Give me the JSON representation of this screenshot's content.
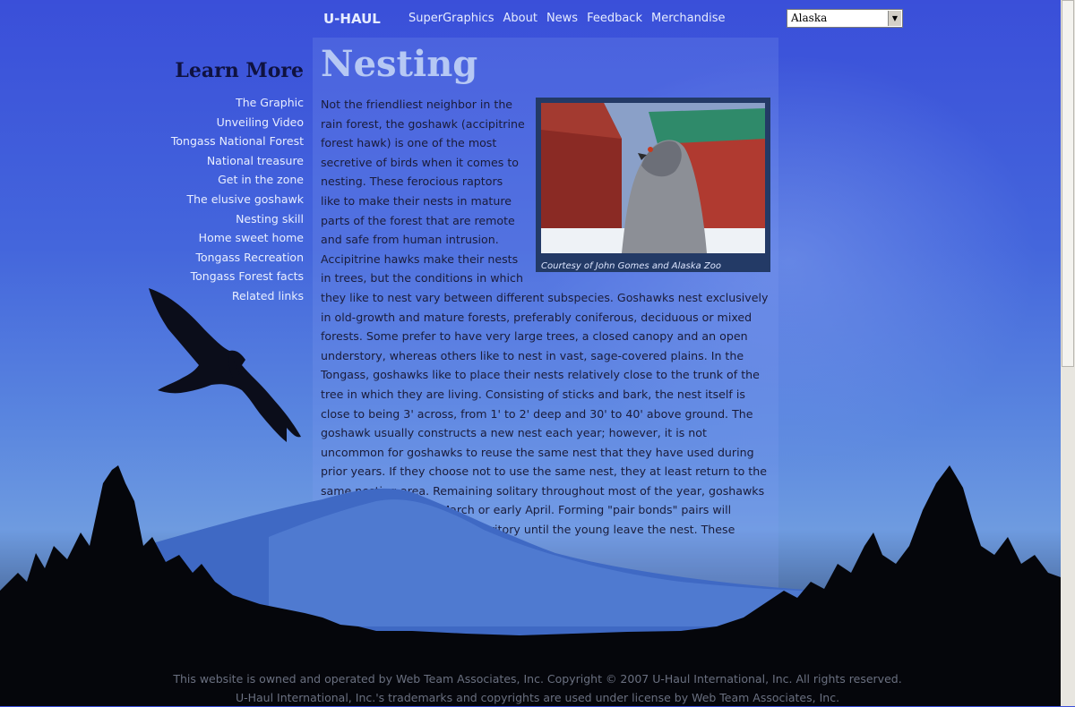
{
  "nav": {
    "logo": "U-HAUL",
    "links": [
      "SuperGraphics",
      "About",
      "News",
      "Feedback",
      "Merchandise"
    ],
    "state_select": "Alaska"
  },
  "sidebar": {
    "heading": "Learn More",
    "items": [
      "The Graphic",
      "Unveiling Video",
      "Tongass National Forest",
      "National treasure",
      "Get in the zone",
      "The elusive goshawk",
      "Nesting skill",
      "Home sweet home",
      "Tongass Recreation",
      "Tongass Forest facts",
      "Related links"
    ]
  },
  "article": {
    "title": "Nesting",
    "photo_caption": "Courtesy of John Gomes and Alaska Zoo",
    "body": "Not the friendliest neighbor in the rain forest, the goshawk (accipitrine forest hawk) is one of the most secretive of birds when it comes to nesting. These ferocious raptors like to make their nests in mature parts of the forest that are remote and safe from human intrusion. Accipitrine hawks make their nests in trees, but the conditions in which they like to nest vary between different subspecies. Goshawks nest exclusively in old-growth and mature forests, preferably coniferous, deciduous or mixed forests. Some prefer to have very large trees, a closed canopy and an open understory, whereas others like to nest in vast, sage-covered plains. In the Tongass, goshawks like to place their nests relatively close to the trunk of the tree in which they are living. Consisting of sticks and bark, the nest itself is close to being 3' across, from 1' to 2' deep and 30' to 40' above ground. The goshawk usually constructs a new nest each year; however, it is not uncommon for goshawks to reuse the same nest that they have used during prior years. If they choose not to use the same nest, they at least return to the same nesting area. Remaining solitary throughout most of the year, goshawks begin nesting in late March or early April. Forming \"pair bonds\" pairs will remain mated in the same territory until the young leave the nest. These young are ready before"
  },
  "footer": {
    "line1": "This website is owned and operated by Web Team Associates, Inc. Copyright © 2007 U-Haul International, Inc. All rights reserved.",
    "line2": "U-Haul International, Inc.'s trademarks and copyrights are used under license by Web Team Associates, Inc."
  }
}
